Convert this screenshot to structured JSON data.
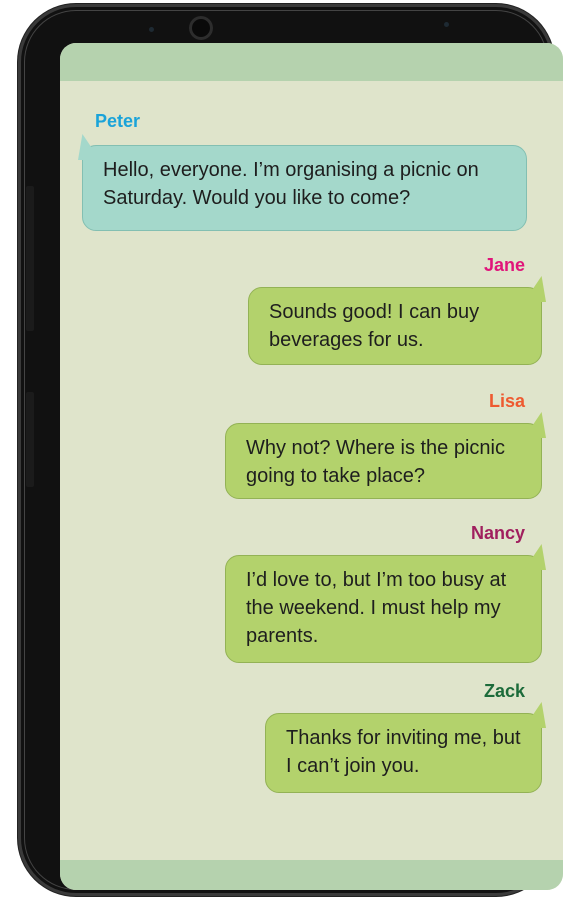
{
  "chat": {
    "messages": [
      {
        "sender": "Peter",
        "sender_color": "#1aa3d9",
        "text": "Hello, everyone. I’m organising a picnic on Saturday. Would you like to come?",
        "side": "left"
      },
      {
        "sender": "Jane",
        "sender_color": "#e0157a",
        "text": "Sounds good! I can buy beverages for us.",
        "side": "right"
      },
      {
        "sender": "Lisa",
        "sender_color": "#ee5a30",
        "text": "Why not? Where is the picnic going to take place?",
        "side": "right"
      },
      {
        "sender": "Nancy",
        "sender_color": "#a01f5e",
        "text": "I’d love to, but I’m too busy at the weekend. I must help my parents.",
        "side": "right"
      },
      {
        "sender": "Zack",
        "sender_color": "#1c6b3a",
        "text": "Thanks for inviting me, but I can’t join you.",
        "side": "right"
      }
    ]
  },
  "theme": {
    "screen_bg": "#dfe4cb",
    "bar_color": "#b5d2ae",
    "left_bubble": "#a4d8cb",
    "right_bubble": "#b3d26c"
  }
}
